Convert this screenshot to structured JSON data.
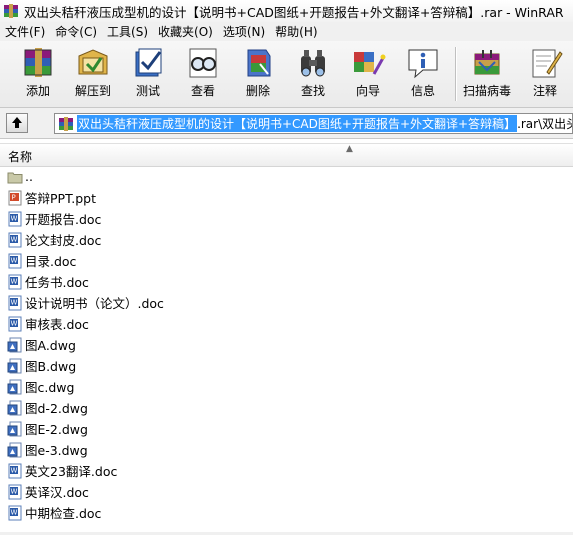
{
  "window": {
    "title": "双出头秸秆液压成型机的设计【说明书+CAD图纸+开题报告+外文翻译+答辩稿】.rar - WinRAR"
  },
  "menu": [
    "文件(F)",
    "命令(C)",
    "工具(S)",
    "收藏夹(O)",
    "选项(N)",
    "帮助(H)"
  ],
  "toolbar": {
    "buttons": [
      {
        "label": "添加",
        "icon": "add-archive-icon"
      },
      {
        "label": "解压到",
        "icon": "extract-to-icon"
      },
      {
        "label": "测试",
        "icon": "test-icon"
      },
      {
        "label": "查看",
        "icon": "view-icon"
      },
      {
        "label": "删除",
        "icon": "delete-icon"
      },
      {
        "label": "查找",
        "icon": "find-icon"
      },
      {
        "label": "向导",
        "icon": "wizard-icon"
      },
      {
        "label": "信息",
        "icon": "info-icon"
      },
      {
        "label": "扫描病毒",
        "icon": "virus-scan-icon"
      },
      {
        "label": "注释",
        "icon": "comment-icon"
      }
    ]
  },
  "address": {
    "selected": "双出头秸秆液压成型机的设计【说明书+CAD图纸+开题报告+外文翻译+答辩稿】",
    "rest": ".rar\\双出头"
  },
  "columns": {
    "name": "名称"
  },
  "files": [
    {
      "name": "..",
      "type": "folder"
    },
    {
      "name": "答辩PPT.ppt",
      "type": "ppt"
    },
    {
      "name": "开题报告.doc",
      "type": "doc"
    },
    {
      "name": "论文封皮.doc",
      "type": "doc"
    },
    {
      "name": "目录.doc",
      "type": "doc"
    },
    {
      "name": "任务书.doc",
      "type": "doc"
    },
    {
      "name": "设计说明书（论文）.doc",
      "type": "doc"
    },
    {
      "name": "审核表.doc",
      "type": "doc"
    },
    {
      "name": "图A.dwg",
      "type": "dwg"
    },
    {
      "name": "图B.dwg",
      "type": "dwg"
    },
    {
      "name": "图c.dwg",
      "type": "dwg"
    },
    {
      "name": "图d-2.dwg",
      "type": "dwg"
    },
    {
      "name": "图E-2.dwg",
      "type": "dwg"
    },
    {
      "name": "图e-3.dwg",
      "type": "dwg"
    },
    {
      "name": "英文23翻译.doc",
      "type": "doc"
    },
    {
      "name": "英译汉.doc",
      "type": "doc"
    },
    {
      "name": "中期检查.doc",
      "type": "doc"
    }
  ]
}
